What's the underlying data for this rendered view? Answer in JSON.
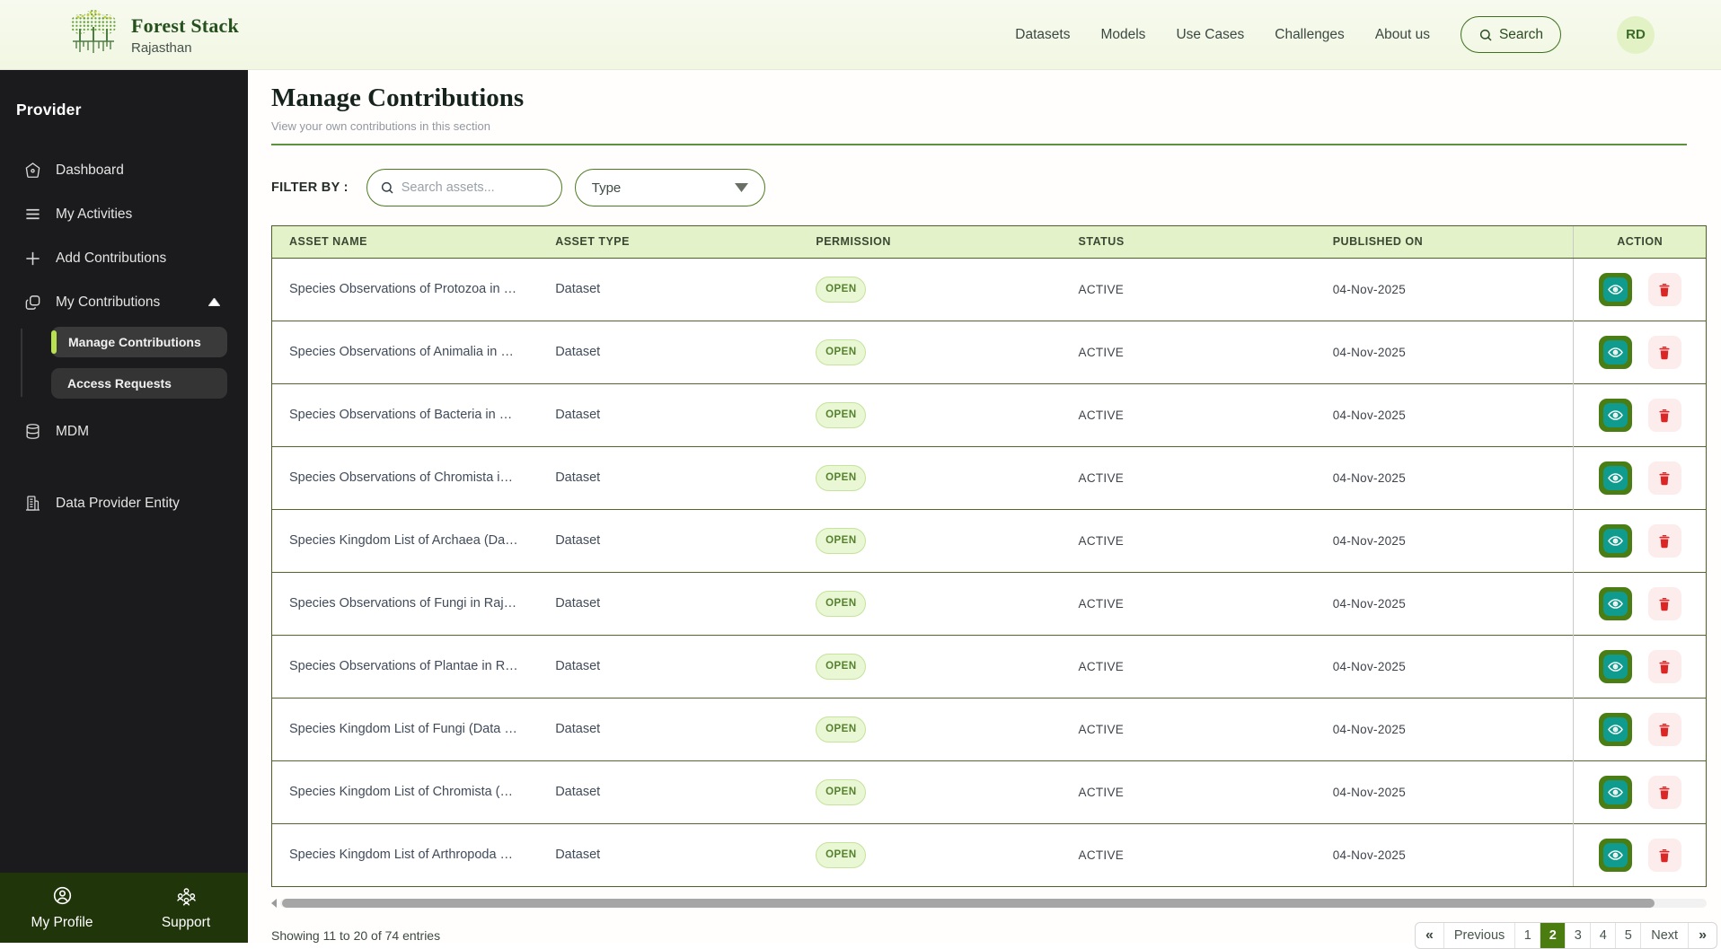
{
  "brand": {
    "title": "Forest Stack",
    "subtitle": "Rajasthan"
  },
  "header": {
    "nav": [
      {
        "label": "Datasets"
      },
      {
        "label": "Models"
      },
      {
        "label": "Use Cases"
      },
      {
        "label": "Challenges"
      },
      {
        "label": "About us"
      }
    ],
    "search_label": "Search",
    "avatar_initials": "RD"
  },
  "sidebar": {
    "section_label": "Provider",
    "items": [
      {
        "label": "Dashboard",
        "icon": "home-icon"
      },
      {
        "label": "My Activities",
        "icon": "menu-lines-icon"
      },
      {
        "label": "Add Contributions",
        "icon": "plus-icon"
      },
      {
        "label": "My Contributions",
        "icon": "layers-icon",
        "expanded": true
      },
      {
        "label": "MDM",
        "icon": "database-icon"
      },
      {
        "label": "Data Provider Entity",
        "icon": "building-icon"
      }
    ],
    "submenu": [
      {
        "label": "Manage Contributions",
        "active": true
      },
      {
        "label": "Access Requests",
        "active": false
      }
    ],
    "footer": [
      {
        "label": "My Profile",
        "icon": "user-circle-icon"
      },
      {
        "label": "Support",
        "icon": "people-icon"
      }
    ]
  },
  "page": {
    "title": "Manage Contributions",
    "subtitle": "View your own contributions in this section",
    "filter_label": "FILTER BY :",
    "search_placeholder": "Search assets...",
    "type_placeholder": "Type"
  },
  "table": {
    "columns": [
      "ASSET NAME",
      "ASSET TYPE",
      "PERMISSION",
      "STATUS",
      "PUBLISHED ON",
      "ACTION"
    ],
    "rows": [
      {
        "name": "Species Observations of Protozoa in …",
        "type": "Dataset",
        "permission": "OPEN",
        "status": "ACTIVE",
        "published": "04-Nov-2025"
      },
      {
        "name": "Species Observations of Animalia in …",
        "type": "Dataset",
        "permission": "OPEN",
        "status": "ACTIVE",
        "published": "04-Nov-2025"
      },
      {
        "name": "Species Observations of Bacteria in …",
        "type": "Dataset",
        "permission": "OPEN",
        "status": "ACTIVE",
        "published": "04-Nov-2025"
      },
      {
        "name": "Species Observations of Chromista i…",
        "type": "Dataset",
        "permission": "OPEN",
        "status": "ACTIVE",
        "published": "04-Nov-2025"
      },
      {
        "name": "Species Kingdom List of Archaea (Da…",
        "type": "Dataset",
        "permission": "OPEN",
        "status": "ACTIVE",
        "published": "04-Nov-2025"
      },
      {
        "name": "Species Observations of Fungi in Raj…",
        "type": "Dataset",
        "permission": "OPEN",
        "status": "ACTIVE",
        "published": "04-Nov-2025"
      },
      {
        "name": "Species Observations of Plantae in R…",
        "type": "Dataset",
        "permission": "OPEN",
        "status": "ACTIVE",
        "published": "04-Nov-2025"
      },
      {
        "name": "Species Kingdom List of Fungi (Data …",
        "type": "Dataset",
        "permission": "OPEN",
        "status": "ACTIVE",
        "published": "04-Nov-2025"
      },
      {
        "name": "Species Kingdom List of Chromista (…",
        "type": "Dataset",
        "permission": "OPEN",
        "status": "ACTIVE",
        "published": "04-Nov-2025"
      },
      {
        "name": "Species Kingdom List of Arthropoda …",
        "type": "Dataset",
        "permission": "OPEN",
        "status": "ACTIVE",
        "published": "04-Nov-2025"
      }
    ]
  },
  "footer": {
    "showing": "Showing 11 to 20 of 74 entries",
    "pagination": {
      "first": "«",
      "previous": "Previous",
      "pages": [
        "1",
        "2",
        "3",
        "4",
        "5"
      ],
      "active_page": "2",
      "next": "Next",
      "last": "»"
    }
  },
  "colors": {
    "accent_green": "#4a7c10",
    "eye_teal": "#0f9b8d",
    "danger_red": "#dc2626",
    "badge_bg": "#e9f7d4",
    "header_bg": "#f3f8e7",
    "table_header_bg": "#e4f2c9",
    "sidebar_bg": "#1b1b1d",
    "sidebar_footer_bg": "#20350a",
    "submenu_accent": "#b9e24e"
  }
}
